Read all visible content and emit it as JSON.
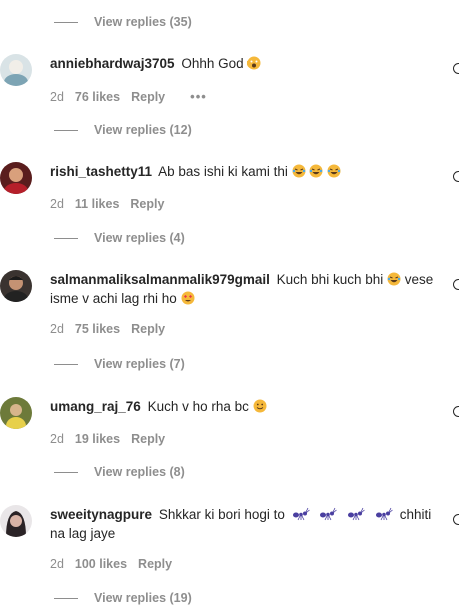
{
  "top_view_replies": "View replies (35)",
  "comments": [
    {
      "username": "anniebhardwaj3705",
      "text": "Ohhh God",
      "time": "2d",
      "likes": "76 likes",
      "reply": "Reply",
      "more": "•••",
      "view_replies": "View replies (12)"
    },
    {
      "username": "rishi_tashetty11",
      "text": "Ab bas ishi ki kami thi",
      "time": "2d",
      "likes": "11 likes",
      "reply": "Reply",
      "view_replies": "View replies (4)"
    },
    {
      "username": "salmanmaliksalmanmalik979gmail",
      "text": "Kuch bhi kuch bhi",
      "text2": "vese isme v achi lag rhi ho",
      "time": "2d",
      "likes": "75 likes",
      "reply": "Reply",
      "view_replies": "View replies (7)"
    },
    {
      "username": "umang_raj_76",
      "text": "Kuch v ho rha bc",
      "time": "2d",
      "likes": "19 likes",
      "reply": "Reply",
      "view_replies": "View replies (8)"
    },
    {
      "username": "sweeitynagpure",
      "text": "Shkkar ki bori hogi to",
      "text2": "chhiti na lag jaye",
      "time": "2d",
      "likes": "100 likes",
      "reply": "Reply",
      "view_replies": "View replies (19)"
    }
  ],
  "colors": {
    "text": "#262626",
    "secondary": "#8e8e8e"
  },
  "icons": [
    "heart-outline-icon",
    "scream-emoji",
    "laughing-emoji",
    "heart-eyes-emoji",
    "smile-emoji",
    "ant-emoji"
  ]
}
